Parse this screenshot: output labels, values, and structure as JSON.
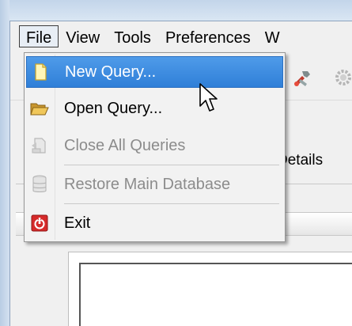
{
  "menubar": {
    "items": [
      {
        "label": "File",
        "active": true
      },
      {
        "label": "View"
      },
      {
        "label": "Tools"
      },
      {
        "label": "Preferences"
      },
      {
        "label": "W"
      }
    ]
  },
  "file_menu": {
    "items": [
      {
        "label": "New Query...",
        "icon": "new-document-icon",
        "state": "highlighted"
      },
      {
        "label": "Open Query...",
        "icon": "open-folder-icon",
        "state": "enabled"
      },
      {
        "label": "Close All Queries",
        "icon": "close-document-icon",
        "state": "disabled"
      },
      {
        "label": "Restore Main Database",
        "icon": "database-icon",
        "state": "disabled"
      },
      {
        "label": "Exit",
        "icon": "exit-power-icon",
        "state": "enabled"
      }
    ]
  },
  "background": {
    "tab_label": "Details"
  },
  "colors": {
    "highlight": "#3c8ce0",
    "menu_bg": "#f2f2f2",
    "disabled_text": "#8c8c8c",
    "exit_red": "#d62a2a",
    "folder_yellow": "#e3b54a"
  },
  "toolbar": {
    "icons": [
      "wrench-icon",
      "gear-icon"
    ]
  }
}
